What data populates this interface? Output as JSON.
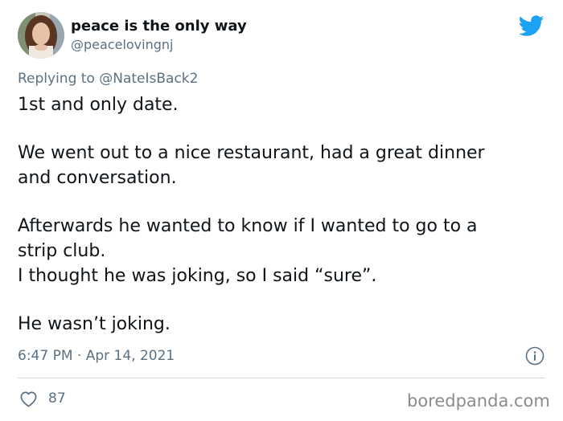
{
  "author": {
    "display_name": "peace is the only way",
    "handle": "@peacelovingnj"
  },
  "icons": {
    "brand": "twitter-bird-icon",
    "info": "info-icon",
    "like": "heart-icon"
  },
  "colors": {
    "twitter_blue": "#1da1f2",
    "muted_text": "#5b7083",
    "main_text": "#0f1419"
  },
  "reply": {
    "prefix": "Replying to",
    "target": "@NateIsBack2"
  },
  "tweet_lines": [
    "1st and only date.",
    "We went out to a nice restaurant, had a great dinner",
    "and conversation.",
    "Afterwards he wanted to know if I wanted to go to a",
    "strip club.",
    "I thought he was joking, so I said “sure”.",
    "He wasn’t joking."
  ],
  "timestamp": "6:47 PM · Apr 14, 2021",
  "likes": "87",
  "watermark": "boredpanda.com"
}
